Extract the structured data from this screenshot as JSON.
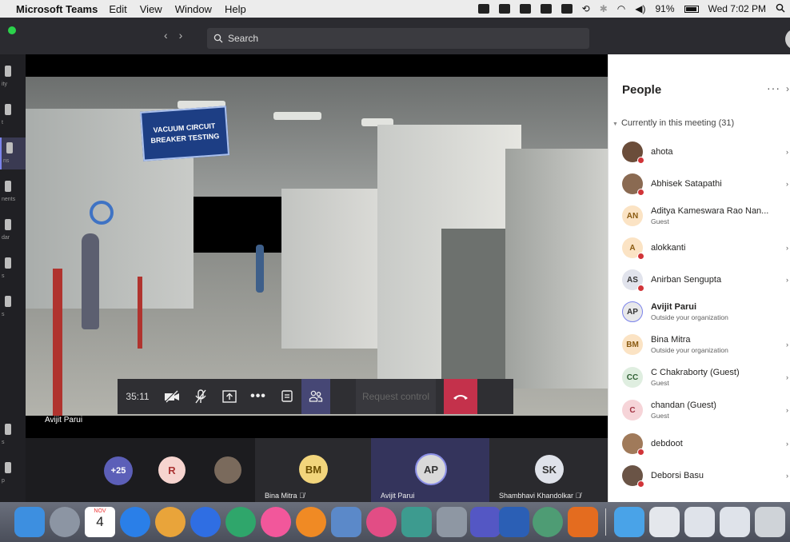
{
  "menubar": {
    "app": "Microsoft Teams",
    "items": [
      "Edit",
      "View",
      "Window",
      "Help"
    ],
    "battery": "91%",
    "clock": "Wed 7:02 PM"
  },
  "titlebar": {
    "search_placeholder": "Search"
  },
  "rail": {
    "items": [
      {
        "label": "ity",
        "icon": "activity-icon"
      },
      {
        "label": "t",
        "icon": "chat-icon"
      },
      {
        "label": "ns",
        "icon": "teams-icon"
      },
      {
        "label": "nents",
        "icon": "assignments-icon"
      },
      {
        "label": "dar",
        "icon": "calendar-icon"
      },
      {
        "label": "s",
        "icon": "calls-icon"
      },
      {
        "label": "s",
        "icon": "files-icon"
      },
      {
        "label": "s",
        "icon": "apps-icon"
      },
      {
        "label": "p",
        "icon": "help-icon"
      }
    ]
  },
  "stage": {
    "sign_text": "VACUUM CIRCUIT BREAKER TESTING",
    "presenter_name": "Avijit Parui"
  },
  "controls": {
    "timer": "35:11",
    "request_control": "Request control"
  },
  "strip": {
    "overflow": "+25",
    "r_initial": "R",
    "tiles": [
      {
        "initials": "BM",
        "name": "Bina Mitra"
      },
      {
        "initials": "AP",
        "name": "Avijit Parui"
      },
      {
        "initials": "SK",
        "name": "Shambhavi Khandolkar"
      }
    ]
  },
  "people": {
    "title": "People",
    "section": "Currently in this meeting (31)",
    "participants": [
      {
        "name": "ahota",
        "sub": "",
        "avatar": "photo"
      },
      {
        "name": "Abhisek Satapathi",
        "sub": "",
        "avatar": "photo"
      },
      {
        "name": "Aditya Kameswara Rao Nan...",
        "sub": "Guest",
        "avatar": "AN"
      },
      {
        "name": "alokkanti",
        "sub": "",
        "avatar": "A"
      },
      {
        "name": "Anirban Sengupta",
        "sub": "",
        "avatar": "AS"
      },
      {
        "name": "Avijit Parui",
        "sub": "Outside your organization",
        "avatar": "AP"
      },
      {
        "name": "Bina Mitra",
        "sub": "Outside your organization",
        "avatar": "BM"
      },
      {
        "name": "C Chakraborty (Guest)",
        "sub": "Guest",
        "avatar": "CC"
      },
      {
        "name": "chandan (Guest)",
        "sub": "Guest",
        "avatar": "C"
      },
      {
        "name": "debdoot",
        "sub": "",
        "avatar": "photo"
      },
      {
        "name": "Deborsi Basu",
        "sub": "",
        "avatar": "photo"
      }
    ]
  },
  "dock": {
    "calendar_month": "NOV",
    "calendar_day": "4"
  }
}
